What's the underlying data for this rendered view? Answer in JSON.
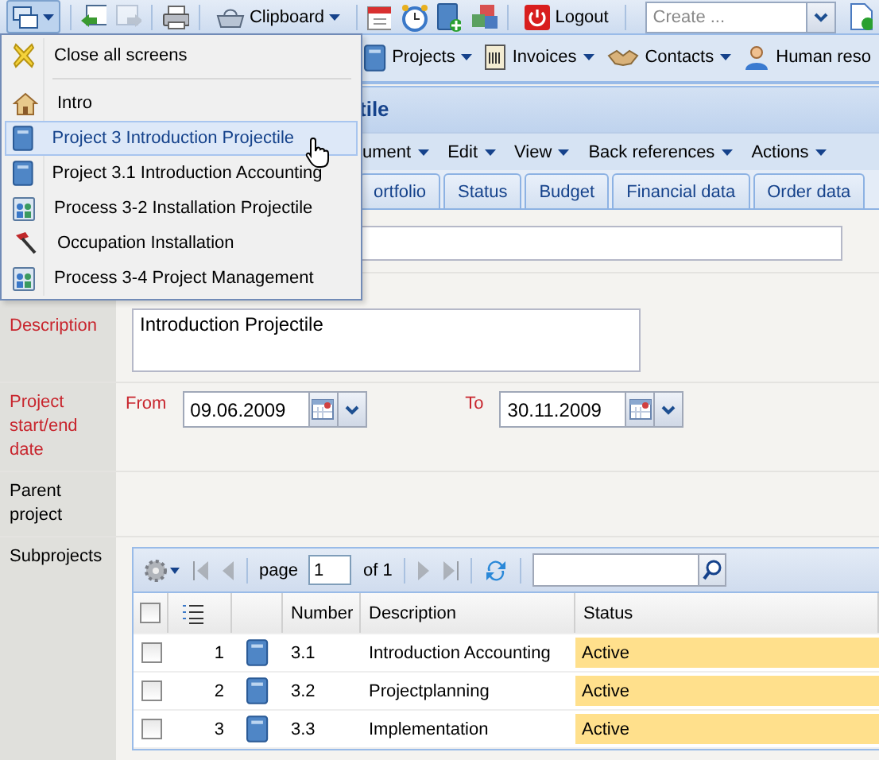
{
  "toolbar": {
    "clipboard": "Clipboard",
    "logout": "Logout",
    "create_placeholder": "Create ..."
  },
  "menubar": [
    {
      "label": "Projects",
      "dropdown": true
    },
    {
      "label": "Invoices",
      "dropdown": true
    },
    {
      "label": "Contacts",
      "dropdown": true
    },
    {
      "label": "Human reso",
      "dropdown": false
    }
  ],
  "window": {
    "title": "tile"
  },
  "doc_menu": [
    "ument",
    "Edit",
    "View",
    "Back references",
    "Actions"
  ],
  "tabs": [
    {
      "label": "ortfolio",
      "selected": false
    },
    {
      "label": "Status",
      "selected": false
    },
    {
      "label": "Budget",
      "selected": false
    },
    {
      "label": "Financial data",
      "selected": false
    },
    {
      "label": "Order data",
      "selected": false
    }
  ],
  "description": {
    "label": "Description",
    "required": true,
    "value": "Introduction Projectile"
  },
  "dates": {
    "label": "Project start/end date",
    "required": true,
    "from_label": "From",
    "from": "09.06.2009",
    "to_label": "To",
    "to": "30.11.2009"
  },
  "parent_project": {
    "label": "Parent project",
    "required": false
  },
  "subprojects": {
    "label": "Subprojects",
    "required": false,
    "select_all_checked": false,
    "pager": {
      "page_label": "page",
      "page": "1",
      "of": "of 1"
    },
    "columns": [
      "Number",
      "Description",
      "Status"
    ],
    "rows": [
      {
        "index": "1",
        "number": "3.1",
        "description": "Introduction Accounting",
        "status": "Active",
        "checked": false
      },
      {
        "index": "2",
        "number": "3.2",
        "description": "Projectplanning",
        "status": "Active",
        "checked": false
      },
      {
        "index": "3",
        "number": "3.3",
        "description": "Implementation",
        "status": "Active",
        "checked": false
      }
    ]
  },
  "screens_menu": {
    "items": [
      {
        "kind": "close",
        "label": "Close all screens",
        "selected": false
      },
      {
        "kind": "home",
        "label": "Intro",
        "selected": false
      },
      {
        "kind": "project",
        "label": "Project 3 Introduction Projectile",
        "selected": true
      },
      {
        "kind": "project",
        "label": "Project 3.1 Introduction Accounting",
        "selected": false
      },
      {
        "kind": "process",
        "label": "Process 3-2 Installation Projectile",
        "selected": false
      },
      {
        "kind": "occupation",
        "label": "Occupation Installation",
        "selected": false
      },
      {
        "kind": "process",
        "label": "Process 3-4 Project Management",
        "selected": false
      }
    ]
  }
}
